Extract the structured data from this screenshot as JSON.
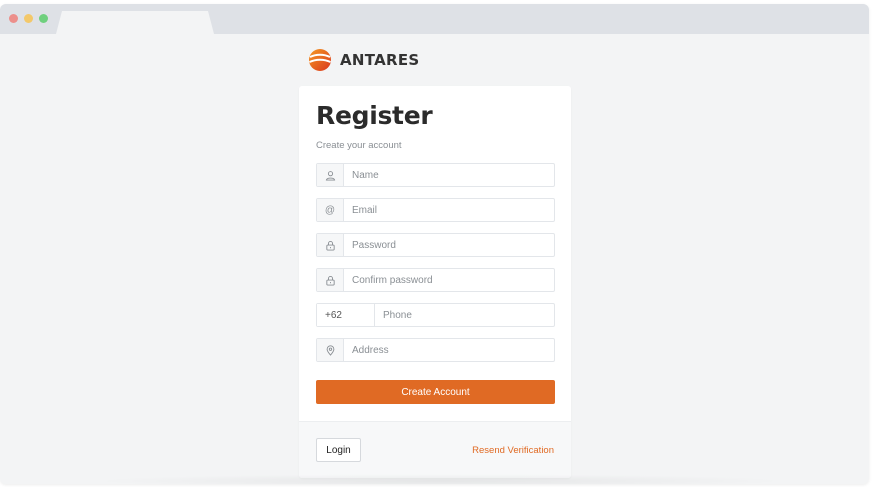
{
  "brand": {
    "name": "ANTARES"
  },
  "register": {
    "title": "Register",
    "subtitle": "Create your account",
    "fields": {
      "name": {
        "placeholder": "Name",
        "value": "",
        "icon": "user-icon"
      },
      "email": {
        "placeholder": "Email",
        "value": "",
        "icon": "at-icon",
        "addon_text": "@"
      },
      "password": {
        "placeholder": "Password",
        "value": "",
        "icon": "lock-icon"
      },
      "confirm_password": {
        "placeholder": "Confirm password",
        "value": "",
        "icon": "lock-icon"
      },
      "phone": {
        "country_code": "+62",
        "placeholder": "Phone",
        "value": ""
      },
      "address": {
        "placeholder": "Address",
        "value": "",
        "icon": "location-pin-icon"
      }
    },
    "submit_label": "Create Account"
  },
  "footer": {
    "login_label": "Login",
    "resend_label": "Resend Verification"
  },
  "colors": {
    "accent": "#e06a24",
    "page_bg": "#f3f4f5",
    "chrome_bg": "#dee1e6"
  }
}
